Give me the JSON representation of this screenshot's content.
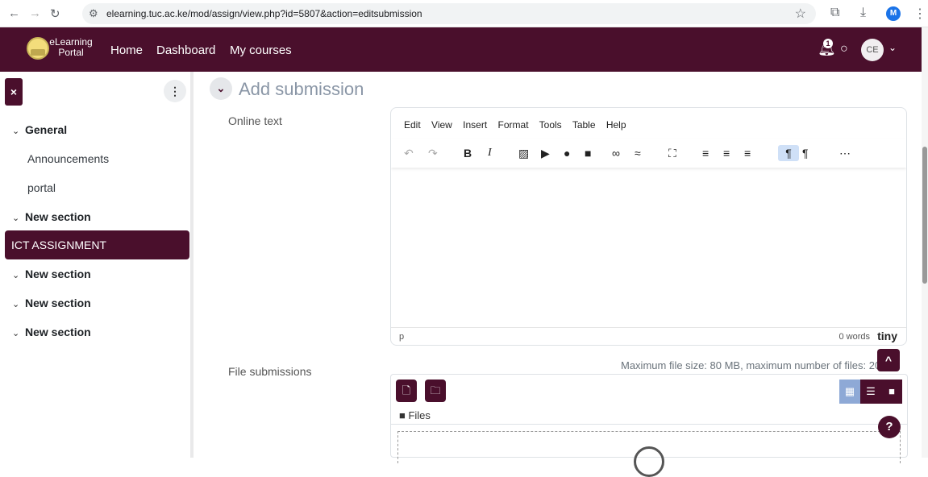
{
  "browser": {
    "url": "elearning.tuc.ac.ke/mod/assign/view.php?id=5807&action=editsubmission",
    "profile_initial": "M"
  },
  "navbar": {
    "logo_text": "eLearning Portal",
    "links": [
      "Home",
      "Dashboard",
      "My courses"
    ],
    "notification_count": "1",
    "user_initials": "CE"
  },
  "sidebar": {
    "close_label": "×",
    "items": [
      {
        "label": "General",
        "type": "section"
      },
      {
        "label": "Announcements",
        "type": "link"
      },
      {
        "label": "portal",
        "type": "link"
      },
      {
        "label": "New section",
        "type": "section"
      },
      {
        "label": "ICT ASSIGNMENT",
        "type": "active"
      },
      {
        "label": "New section",
        "type": "section"
      },
      {
        "label": "New section",
        "type": "section"
      },
      {
        "label": "New section",
        "type": "section"
      }
    ]
  },
  "main": {
    "title": "Add submission",
    "online_text_label": "Online text",
    "file_submissions_label": "File submissions",
    "max_info": "Maximum file size: 80 MB, maximum number of files: 20",
    "files_path": "Files"
  },
  "editor": {
    "menu": [
      "Edit",
      "View",
      "Insert",
      "Format",
      "Tools",
      "Table",
      "Help"
    ],
    "status_element": "p",
    "word_count": "0 words",
    "brand": "tiny"
  },
  "colors": {
    "brand": "#4a0f2c",
    "accent_light": "#cfe0f7"
  }
}
